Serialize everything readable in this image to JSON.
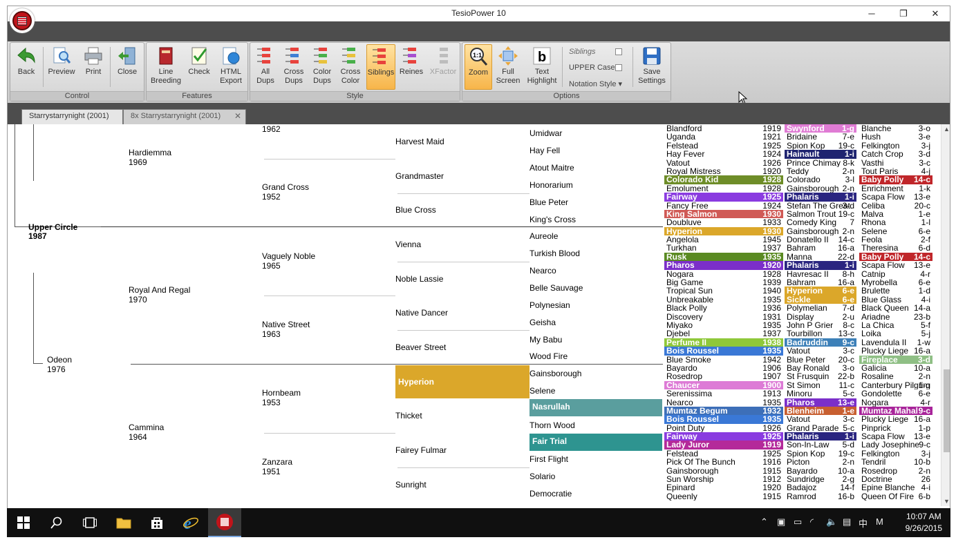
{
  "window": {
    "title": "TesioPower 10",
    "minimize": "─",
    "maximize": "❐",
    "close": "✕"
  },
  "ribbon": {
    "groups": {
      "control": "Control",
      "features": "Features",
      "style": "Style",
      "options": "Options"
    },
    "buttons": {
      "back": "Back",
      "preview": "Preview",
      "print": "Print",
      "close": "Close",
      "line_breeding_1": "Line",
      "line_breeding_2": "Breeding",
      "check": "Check",
      "html_1": "HTML",
      "html_2": "Export",
      "all_1": "All",
      "all_2": "Dups",
      "cross_1": "Cross",
      "cross_2": "Dups",
      "color_1": "Color",
      "color_2": "Dups",
      "crosscolor_1": "Cross",
      "crosscolor_2": "Color",
      "siblings": "Siblings",
      "reines": "Reines",
      "xfactor": "XFactor",
      "zoom": "Zoom",
      "full_1": "Full",
      "full_2": "Screen",
      "text_1": "Text",
      "text_2": "Highlight",
      "save_1": "Save",
      "save_2": "Settings"
    },
    "options": {
      "siblings": "Siblings",
      "upper_case": "UPPER Case",
      "notation_style": "Notation Style ▾"
    }
  },
  "tabs": [
    {
      "label": "Starrystarrynight (2001)"
    },
    {
      "label": "8x Starrystarrynight (2001)",
      "close": "✕"
    }
  ],
  "pedigree": {
    "g1": [
      {
        "name": "Upper Circle",
        "year": "1987"
      }
    ],
    "g2": [
      {
        "name": "Hardiemma",
        "year": "1969"
      },
      {
        "name": "Odeon",
        "year": "1976"
      }
    ],
    "g3": [
      {
        "name": "Royal And Regal",
        "year": "1970"
      },
      {
        "name": "Cammina",
        "year": "1964"
      }
    ],
    "g4": [
      {
        "name": "",
        "year": "1962"
      },
      {
        "name": "Grand Cross",
        "year": "1952"
      },
      {
        "name": "Vaguely Noble",
        "year": "1965"
      },
      {
        "name": "Native Street",
        "year": "1963"
      },
      {
        "name": "Hornbeam",
        "year": "1953"
      },
      {
        "name": "Zanzara",
        "year": "1951"
      }
    ],
    "g5": [
      "Harvest Maid",
      "Grandmaster",
      "Blue Cross",
      "Vienna",
      "Noble Lassie",
      "Native Dancer",
      "Beaver Street",
      "Hyperion",
      "Thicket",
      "Fairey Fulmar",
      "Sunright"
    ],
    "g6": [
      "Umidwar",
      "Hay Fell",
      "Atout Maitre",
      "Honorarium",
      "Blue Peter",
      "King's Cross",
      "Aureole",
      "Turkish Blood",
      "Nearco",
      "Belle Sauvage",
      "Polynesian",
      "Geisha",
      "My Babu",
      "Wood Fire",
      "Gainsborough",
      "Selene",
      "Nasrullah",
      "Thorn Wood",
      "Fair Trial",
      "First Flight",
      "Solario",
      "Democratie"
    ],
    "col7": [
      [
        "Blandford",
        "1919"
      ],
      [
        "Uganda",
        "1921"
      ],
      [
        "Felstead",
        "1925"
      ],
      [
        "Hay Fever",
        "1924"
      ],
      [
        "Vatout",
        "1926"
      ],
      [
        "Royal Mistress",
        "1920"
      ],
      [
        "Colorado Kid",
        "1928"
      ],
      [
        "Emolument",
        "1928"
      ],
      [
        "Fairway",
        "1925"
      ],
      [
        "Fancy Free",
        "1924"
      ],
      [
        "King Salmon",
        "1930"
      ],
      [
        "Doubluve",
        "1933"
      ],
      [
        "Hyperion",
        "1930"
      ],
      [
        "Angelola",
        "1945"
      ],
      [
        "Turkhan",
        "1937"
      ],
      [
        "Rusk",
        "1935"
      ],
      [
        "Pharos",
        "1920"
      ],
      [
        "Nogara",
        "1928"
      ],
      [
        "Big Game",
        "1939"
      ],
      [
        "Tropical Sun",
        "1940"
      ],
      [
        "Unbreakable",
        "1935"
      ],
      [
        "Black Polly",
        "1936"
      ],
      [
        "Discovery",
        "1931"
      ],
      [
        "Miyako",
        "1935"
      ],
      [
        "Djebel",
        "1937"
      ],
      [
        "Perfume II",
        "1938"
      ],
      [
        "Bois Roussel",
        "1935"
      ],
      [
        "Blue Smoke",
        "1942"
      ],
      [
        "Bayardo",
        "1906"
      ],
      [
        "Rosedrop",
        "1907"
      ],
      [
        "Chaucer",
        "1900"
      ],
      [
        "Serenissima",
        "1913"
      ],
      [
        "Nearco",
        "1935"
      ],
      [
        "Mumtaz Begum",
        "1932"
      ],
      [
        "Bois Roussel",
        "1935"
      ],
      [
        "Point Duty",
        "1926"
      ],
      [
        "Fairway",
        "1925"
      ],
      [
        "Lady Juror",
        "1919"
      ],
      [
        "Felstead",
        "1925"
      ],
      [
        "Pick Of The Bunch",
        "1916"
      ],
      [
        "Gainsborough",
        "1915"
      ],
      [
        "Sun Worship",
        "1912"
      ],
      [
        "Epinard",
        "1920"
      ],
      [
        "Queenly",
        "1915"
      ]
    ],
    "col8": [
      [
        "Swynford",
        "1-g"
      ],
      [
        "Bridaine",
        "7-e"
      ],
      [
        "Spion Kop",
        "19-c"
      ],
      [
        "Hainault",
        "1-i"
      ],
      [
        "Prince Chimay",
        "8-k"
      ],
      [
        "Teddy",
        "2-n"
      ],
      [
        "Colorado",
        "3-l"
      ],
      [
        "Gainsborough",
        "2-n"
      ],
      [
        "Phalaris",
        "1-i"
      ],
      [
        "Stefan The Great",
        "3-d"
      ],
      [
        "Salmon Trout",
        "19-c"
      ],
      [
        "Comedy King",
        "7"
      ],
      [
        "Gainsborough",
        "2-n"
      ],
      [
        "Donatello II",
        "14-c"
      ],
      [
        "Bahram",
        "16-a"
      ],
      [
        "Manna",
        "22-d"
      ],
      [
        "Phalaris",
        "1-i"
      ],
      [
        "Havresac II",
        "8-h"
      ],
      [
        "Bahram",
        "16-a"
      ],
      [
        "Hyperion",
        "6-e"
      ],
      [
        "Sickle",
        "6-e"
      ],
      [
        "Polymelian",
        "7-d"
      ],
      [
        "Display",
        "2-u"
      ],
      [
        "John P Grier",
        "8-c"
      ],
      [
        "Tourbillon",
        "13-c"
      ],
      [
        "Badruddin",
        "9-c"
      ],
      [
        "Vatout",
        "3-c"
      ],
      [
        "Blue Peter",
        "20-c"
      ],
      [
        "Bay Ronald",
        "3-o"
      ],
      [
        "St Frusquin",
        "22-b"
      ],
      [
        "St Simon",
        "11-c"
      ],
      [
        "Minoru",
        "5-c"
      ],
      [
        "Pharos",
        "13-e"
      ],
      [
        "Blenheim",
        "1-e"
      ],
      [
        "Vatout",
        "3-c"
      ],
      [
        "Grand Parade",
        "5-c"
      ],
      [
        "Phalaris",
        "1-i"
      ],
      [
        "Son-In-Law",
        "5-d"
      ],
      [
        "Spion Kop",
        "19-c"
      ],
      [
        "Picton",
        "2-n"
      ],
      [
        "Bayardo",
        "10-a"
      ],
      [
        "Sundridge",
        "2-g"
      ],
      [
        "Badajoz",
        "14-f"
      ],
      [
        "Ramrod",
        "16-b"
      ]
    ],
    "col9": [
      [
        "Blanche",
        "3-o"
      ],
      [
        "Hush",
        "3-e"
      ],
      [
        "Felkington",
        "3-j"
      ],
      [
        "Catch Crop",
        "3-d"
      ],
      [
        "Vasthi",
        "3-c"
      ],
      [
        "Tout Paris",
        "4-j"
      ],
      [
        "Baby Polly",
        "14-c"
      ],
      [
        "Enrichment",
        "1-k"
      ],
      [
        "Scapa Flow",
        "13-e"
      ],
      [
        "Celiba",
        "20-c"
      ],
      [
        "Malva",
        "1-e"
      ],
      [
        "Rhona",
        "1-l"
      ],
      [
        "Selene",
        "6-e"
      ],
      [
        "Feola",
        "2-f"
      ],
      [
        "Theresina",
        "6-d"
      ],
      [
        "Baby Polly",
        "14-c"
      ],
      [
        "Scapa Flow",
        "13-e"
      ],
      [
        "Catnip",
        "4-r"
      ],
      [
        "Myrobella",
        "6-e"
      ],
      [
        "Brulette",
        "1-d"
      ],
      [
        "Blue Glass",
        "4-i"
      ],
      [
        "Black Queen",
        "14-a"
      ],
      [
        "Ariadne",
        "23-b"
      ],
      [
        "La Chica",
        "5-f"
      ],
      [
        "Loika",
        "5-j"
      ],
      [
        "Lavendula II",
        "1-w"
      ],
      [
        "Plucky Liege",
        "16-a"
      ],
      [
        "Fireplace",
        "3-d"
      ],
      [
        "Galicia",
        "10-a"
      ],
      [
        "Rosaline",
        "2-n"
      ],
      [
        "Canterbury Pilgrim",
        "1-g"
      ],
      [
        "Gondolette",
        "6-e"
      ],
      [
        "Nogara",
        "4-r"
      ],
      [
        "Mumtaz Mahal",
        "9-c"
      ],
      [
        "Plucky Liege",
        "16-a"
      ],
      [
        "Pinprick",
        "1-p"
      ],
      [
        "Scapa Flow",
        "13-e"
      ],
      [
        "Lady Josephine",
        "9-c"
      ],
      [
        "Felkington",
        "3-j"
      ],
      [
        "Tendril",
        "10-b"
      ],
      [
        "Rosedrop",
        "2-n"
      ],
      [
        "Doctrine",
        "26"
      ],
      [
        "Epine Blanche",
        "4-i"
      ],
      [
        "Queen Of Fire",
        "6-b"
      ]
    ]
  },
  "highlight_colors": {
    "hyperion": "#dba72a",
    "nasrullah": "#5a9e9e",
    "fair_trial": "#2e9490",
    "fairway": "#8a3be0",
    "phalaris": "#2a2580",
    "pharos": "#7b2fc9",
    "colorado_kid": "#6e8d28",
    "king_salmon": "#d05a56",
    "rusk": "#5a8a22",
    "perfume": "#8fc83a",
    "bois_roussel": "#3a78d6",
    "chaucer": "#dd7bd6",
    "mumtaz_begum": "#3d6fb8",
    "lady_juror": "#b42a9a",
    "swynford": "#e07bd4",
    "hainault": "#1f2470",
    "baby_polly": "#c0262a",
    "sickle": "#dba72a",
    "badruddin": "#3d80b8",
    "blenheim": "#c85f30",
    "mumtaz_mahal": "#a8249a",
    "fireplace": "#8fbf85"
  },
  "taskbar": {
    "time": "10:07 AM",
    "date": "9/26/2015",
    "ime": "中",
    "lang": "M"
  }
}
